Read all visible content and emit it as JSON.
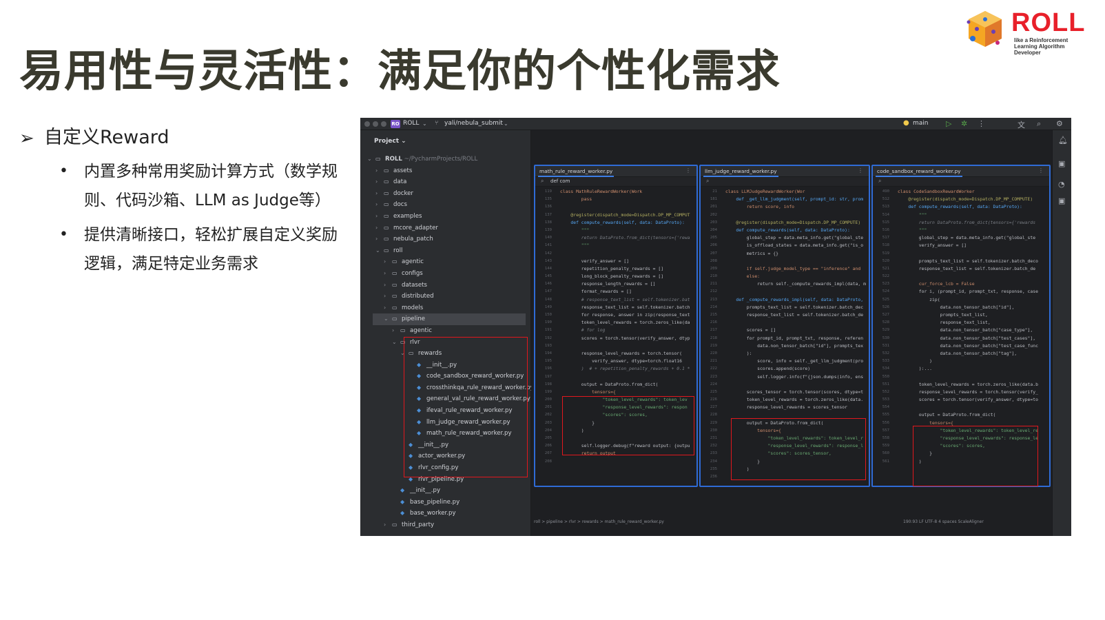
{
  "slide": {
    "title": "易用性与灵活性：满足你的个性化需求",
    "bullet_main": "自定义Reward",
    "sub_bullets": [
      "内置多种常用奖励计算方式（数学规则、代码沙箱、LLM as Judge等）",
      "提供清晰接口，轻松扩展自定义奖励逻辑，满足特定业务需求"
    ]
  },
  "logo": {
    "word": "ROLL",
    "tagline": "like a Reinforcement Learning Algorithm Developer"
  },
  "ide": {
    "titlebar": {
      "project_badge": "RO",
      "project_name": "ROLL",
      "branch": "yali/nebula_submit",
      "run_config": "main"
    },
    "project_panel": {
      "header": "Project",
      "root_name": "ROLL",
      "root_path": "~/PycharmProjects/ROLL",
      "items": [
        {
          "label": "assets",
          "type": "folder",
          "depth": 1,
          "expanded": false
        },
        {
          "label": "data",
          "type": "folder",
          "depth": 1,
          "expanded": false
        },
        {
          "label": "docker",
          "type": "folder",
          "depth": 1,
          "expanded": false
        },
        {
          "label": "docs",
          "type": "folder",
          "depth": 1,
          "expanded": false
        },
        {
          "label": "examples",
          "type": "folder",
          "depth": 1,
          "expanded": false
        },
        {
          "label": "mcore_adapter",
          "type": "folder",
          "depth": 1,
          "expanded": false
        },
        {
          "label": "nebula_patch",
          "type": "folder",
          "depth": 1,
          "expanded": false
        },
        {
          "label": "roll",
          "type": "folder",
          "depth": 1,
          "expanded": true
        },
        {
          "label": "agentic",
          "type": "folder",
          "depth": 2,
          "expanded": false
        },
        {
          "label": "configs",
          "type": "folder",
          "depth": 2,
          "expanded": false
        },
        {
          "label": "datasets",
          "type": "folder",
          "depth": 2,
          "expanded": false
        },
        {
          "label": "distributed",
          "type": "folder",
          "depth": 2,
          "expanded": false
        },
        {
          "label": "models",
          "type": "folder",
          "depth": 2,
          "expanded": false
        },
        {
          "label": "pipeline",
          "type": "folder",
          "depth": 2,
          "expanded": true,
          "selected": true
        },
        {
          "label": "agentic",
          "type": "folder",
          "depth": 3,
          "expanded": false
        },
        {
          "label": "rlvr",
          "type": "folder",
          "depth": 3,
          "expanded": true
        },
        {
          "label": "rewards",
          "type": "folder",
          "depth": 4,
          "expanded": true
        },
        {
          "label": "__init__.py",
          "type": "py",
          "depth": 5
        },
        {
          "label": "code_sandbox_reward_worker.py",
          "type": "py",
          "depth": 5
        },
        {
          "label": "crossthinkqa_rule_reward_worker.py",
          "type": "py",
          "depth": 5
        },
        {
          "label": "general_val_rule_reward_worker.py",
          "type": "py",
          "depth": 5
        },
        {
          "label": "ifeval_rule_reward_worker.py",
          "type": "py",
          "depth": 5
        },
        {
          "label": "llm_judge_reward_worker.py",
          "type": "py",
          "depth": 5
        },
        {
          "label": "math_rule_reward_worker.py",
          "type": "py",
          "depth": 5
        },
        {
          "label": "__init__.py",
          "type": "py",
          "depth": 4
        },
        {
          "label": "actor_worker.py",
          "type": "py",
          "depth": 4
        },
        {
          "label": "rlvr_config.py",
          "type": "py",
          "depth": 4
        },
        {
          "label": "rlvr_pipeline.py",
          "type": "py",
          "depth": 4
        },
        {
          "label": "__init__.py",
          "type": "py",
          "depth": 3
        },
        {
          "label": "base_pipeline.py",
          "type": "py",
          "depth": 3
        },
        {
          "label": "base_worker.py",
          "type": "py",
          "depth": 3
        },
        {
          "label": "third_party",
          "type": "folder",
          "depth": 2,
          "expanded": false
        }
      ]
    },
    "panes": [
      {
        "tab": "math_rule_reward_worker.py",
        "search": "def com",
        "lines": [
          {
            "n": "119",
            "t": "class MathRuleRewardWorker(Work",
            "c": "kw"
          },
          {
            "n": "135",
            "t": "        pass",
            "c": "kw"
          },
          {
            "n": "136",
            "t": ""
          },
          {
            "n": "137",
            "t": "    @register(dispatch_mode=Dispatch.DP_MP_COMPUT",
            "c": "dec"
          },
          {
            "n": "138",
            "t": "    def compute_rewards(self, data: DataProto):",
            "c": "fn"
          },
          {
            "n": "139",
            "t": "        \"\"\"",
            "c": "st2"
          },
          {
            "n": "140",
            "t": "        return DataProto.from_dict(tensors={'rewa",
            "c": "cm"
          },
          {
            "n": "141",
            "t": "        \"\"\"",
            "c": "st2"
          },
          {
            "n": "142",
            "t": ""
          },
          {
            "n": "143",
            "t": "        verify_answer = []"
          },
          {
            "n": "144",
            "t": "        repetition_penalty_rewards = []"
          },
          {
            "n": "145",
            "t": "        long_block_penalty_rewards = []"
          },
          {
            "n": "146",
            "t": "        response_length_rewards = []"
          },
          {
            "n": "147",
            "t": "        format_rewards = []"
          },
          {
            "n": "148",
            "t": "        # response_text_list = self.tokenizer.bat",
            "c": "cm"
          },
          {
            "n": "149",
            "t": "        response_text_list = self.tokenizer.batch"
          },
          {
            "n": "150",
            "t": "        for response, answer in zip(response_text"
          },
          {
            "n": "190",
            "t": "        token_level_rewards = torch.zeros_like(da"
          },
          {
            "n": "191",
            "t": "        # for log",
            "c": "cm"
          },
          {
            "n": "192",
            "t": "        scores = torch.tensor(verify_answer, dtyp"
          },
          {
            "n": "193",
            "t": ""
          },
          {
            "n": "194",
            "t": "        response_level_rewards = torch.tensor("
          },
          {
            "n": "195",
            "t": "            verify_answer, dtype=torch.float16"
          },
          {
            "n": "196",
            "t": "        )  # + repetition_penalty_rewards + 0.1 *",
            "c": "cm"
          },
          {
            "n": "197",
            "t": ""
          },
          {
            "n": "198",
            "t": "        output = DataProto.from_dict("
          },
          {
            "n": "199",
            "t": "            tensors={",
            "c": "kw"
          },
          {
            "n": "200",
            "t": "                \"token_level_rewards\": token_lev",
            "c": "st2"
          },
          {
            "n": "201",
            "t": "                \"response_level_rewards\": respon",
            "c": "st2"
          },
          {
            "n": "202",
            "t": "                \"scores\": scores,",
            "c": "st2"
          },
          {
            "n": "203",
            "t": "            }"
          },
          {
            "n": "204",
            "t": "        )"
          },
          {
            "n": "205",
            "t": ""
          },
          {
            "n": "206",
            "t": "        self.logger.debug(f\"reward output: {outpu"
          },
          {
            "n": "207",
            "t": "        return output",
            "c": "kw"
          },
          {
            "n": "208",
            "t": ""
          }
        ]
      },
      {
        "tab": "llm_judge_reward_worker.py",
        "search": "",
        "lines": [
          {
            "n": "21",
            "t": "class LLMJudgeRewardWorker(Wor",
            "c": "kw"
          },
          {
            "n": "181",
            "t": "    def _get_llm_judgment(self, prompt_id: str, prom",
            "c": "fn"
          },
          {
            "n": "201",
            "t": "        return score, info",
            "c": "kw"
          },
          {
            "n": "202",
            "t": ""
          },
          {
            "n": "203",
            "t": "    @register(dispatch_mode=Dispatch.DP_MP_COMPUTE)",
            "c": "dec"
          },
          {
            "n": "204",
            "t": "    def compute_rewards(self, data: DataProto):",
            "c": "fn"
          },
          {
            "n": "205",
            "t": "        global_step = data.meta_info.get(\"global_ste"
          },
          {
            "n": "206",
            "t": "        is_offload_states = data.meta_info.get(\"is_o"
          },
          {
            "n": "207",
            "t": "        metrics = {}"
          },
          {
            "n": "208",
            "t": ""
          },
          {
            "n": "209",
            "t": "        if self.judge_model_type == \"inference\" and",
            "c": "kw"
          },
          {
            "n": "210",
            "t": "        else:",
            "c": "kw"
          },
          {
            "n": "211",
            "t": "            return self._compute_rewards_impl(data, m"
          },
          {
            "n": "212",
            "t": ""
          },
          {
            "n": "213",
            "t": "    def _compute_rewards_impl(self, data: DataProto,",
            "c": "fn"
          },
          {
            "n": "214",
            "t": "        prompts_text_list = self.tokenizer.batch_dec"
          },
          {
            "n": "215",
            "t": "        response_text_list = self.tokenizer.batch_de"
          },
          {
            "n": "216",
            "t": ""
          },
          {
            "n": "217",
            "t": "        scores = []"
          },
          {
            "n": "218",
            "t": "        for prompt_id, prompt_txt, response, referen"
          },
          {
            "n": "219",
            "t": "            data.non_tensor_batch[\"id\"], prompts_tex"
          },
          {
            "n": "220",
            "t": "        ):"
          },
          {
            "n": "221",
            "t": "            score, info = self._get_llm_judgment(pro"
          },
          {
            "n": "222",
            "t": "            scores.append(score)"
          },
          {
            "n": "223",
            "t": "            self.logger.info(f\"{json.dumps(info, ens"
          },
          {
            "n": "224",
            "t": ""
          },
          {
            "n": "225",
            "t": "        scores_tensor = torch.tensor(scores, dtype=t"
          },
          {
            "n": "226",
            "t": "        token_level_rewards = torch.zeros_like(data."
          },
          {
            "n": "227",
            "t": "        response_level_rewards = scores_tensor"
          },
          {
            "n": "228",
            "t": ""
          },
          {
            "n": "229",
            "t": "        output = DataProto.from_dict("
          },
          {
            "n": "230",
            "t": "            tensors={",
            "c": "kw"
          },
          {
            "n": "231",
            "t": "                \"token_level_rewards\": token_level_r",
            "c": "st2"
          },
          {
            "n": "232",
            "t": "                \"response_level_rewards\": response_l",
            "c": "st2"
          },
          {
            "n": "233",
            "t": "                \"scores\": scores_tensor,",
            "c": "st2"
          },
          {
            "n": "234",
            "t": "            }"
          },
          {
            "n": "235",
            "t": "        )"
          },
          {
            "n": "236",
            "t": ""
          }
        ]
      },
      {
        "tab": "code_sandbox_reward_worker.py",
        "search": "",
        "lines": [
          {
            "n": "490",
            "t": "class CodeSandboxRewardWorker",
            "c": "kw"
          },
          {
            "n": "512",
            "t": "    @register(dispatch_mode=Dispatch.DP_MP_COMPUTE)",
            "c": "dec"
          },
          {
            "n": "513",
            "t": "    def compute_rewards(self, data: DataProto):",
            "c": "fn"
          },
          {
            "n": "514",
            "t": "        \"\"\"",
            "c": "st2"
          },
          {
            "n": "515",
            "t": "        return DataProto.from_dict(tensors={'rewards",
            "c": "cm"
          },
          {
            "n": "516",
            "t": "        \"\"\"",
            "c": "st2"
          },
          {
            "n": "517",
            "t": "        global_step = data.meta_info.get(\"global_ste"
          },
          {
            "n": "518",
            "t": "        verify_answer = []"
          },
          {
            "n": "519",
            "t": ""
          },
          {
            "n": "520",
            "t": "        prompts_text_list = self.tokenizer.batch_deco"
          },
          {
            "n": "521",
            "t": "        response_text_list = self.tokenizer.batch_de"
          },
          {
            "n": "522",
            "t": ""
          },
          {
            "n": "523",
            "t": "        cur_force_lcb = False",
            "c": "kw"
          },
          {
            "n": "524",
            "t": "        for i, (prompt_id, prompt_txt, response, case"
          },
          {
            "n": "525",
            "t": "            zip("
          },
          {
            "n": "526",
            "t": "                data.non_tensor_batch[\"id\"],"
          },
          {
            "n": "527",
            "t": "                prompts_text_list,"
          },
          {
            "n": "528",
            "t": "                response_text_list,"
          },
          {
            "n": "529",
            "t": "                data.non_tensor_batch[\"case_type\"],"
          },
          {
            "n": "530",
            "t": "                data.non_tensor_batch[\"test_cases\"],"
          },
          {
            "n": "531",
            "t": "                data.non_tensor_batch[\"test_case_func"
          },
          {
            "n": "532",
            "t": "                data.non_tensor_batch[\"tag\"],"
          },
          {
            "n": "533",
            "t": "            )"
          },
          {
            "n": "534",
            "t": "        ):..."
          },
          {
            "n": "550",
            "t": ""
          },
          {
            "n": "551",
            "t": "        token_level_rewards = torch.zeros_like(data.b"
          },
          {
            "n": "552",
            "t": "        response_level_rewards = torch.tensor(verify_"
          },
          {
            "n": "553",
            "t": "        scores = torch.tensor(verify_answer, dtype=to"
          },
          {
            "n": "554",
            "t": ""
          },
          {
            "n": "555",
            "t": "        output = DataProto.from_dict("
          },
          {
            "n": "556",
            "t": "            tensors={",
            "c": "kw"
          },
          {
            "n": "557",
            "t": "                \"token_level_rewards\": token_level_re",
            "c": "st2"
          },
          {
            "n": "558",
            "t": "                \"response_level_rewards\": response_le",
            "c": "st2"
          },
          {
            "n": "559",
            "t": "                \"scores\": scores,",
            "c": "st2"
          },
          {
            "n": "560",
            "t": "            }"
          },
          {
            "n": "561",
            "t": "        )"
          }
        ]
      }
    ],
    "breadcrumb": "roll > pipeline > rlvr > rewards > math_rule_reward_worker.py",
    "status_right": "190:93  LF  UTF-8  4 spaces  ScaleAligner"
  }
}
